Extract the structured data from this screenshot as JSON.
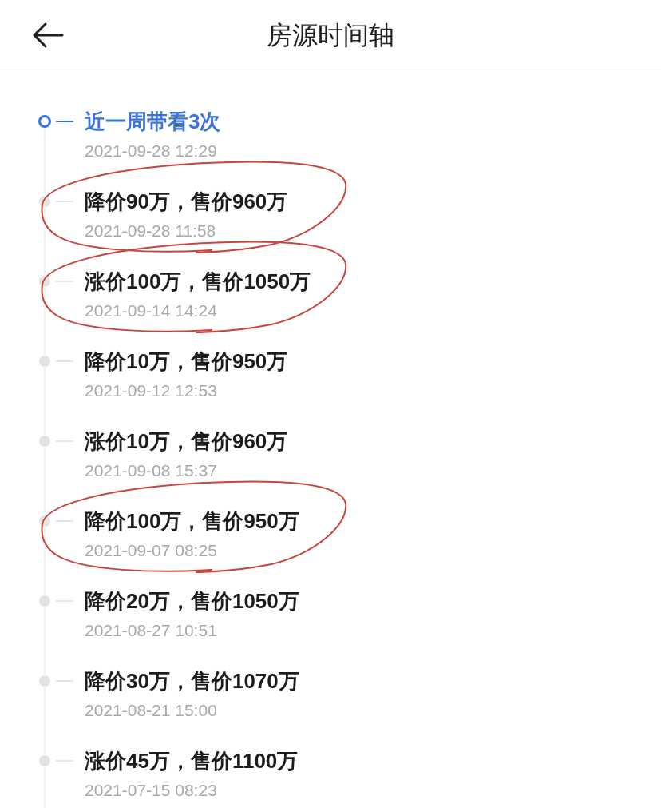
{
  "header": {
    "title": "房源时间轴"
  },
  "timeline": [
    {
      "title": "近一周带看3次",
      "time": "2021-09-28 12:29",
      "current": true,
      "circled": false
    },
    {
      "title": "降价90万，售价960万",
      "time": "2021-09-28 11:58",
      "current": false,
      "circled": true
    },
    {
      "title": "涨价100万，售价1050万",
      "time": "2021-09-14 14:24",
      "current": false,
      "circled": true
    },
    {
      "title": "降价10万，售价950万",
      "time": "2021-09-12 12:53",
      "current": false,
      "circled": false
    },
    {
      "title": "涨价10万，售价960万",
      "time": "2021-09-08 15:37",
      "current": false,
      "circled": false
    },
    {
      "title": "降价100万，售价950万",
      "time": "2021-09-07 08:25",
      "current": false,
      "circled": true
    },
    {
      "title": "降价20万，售价1050万",
      "time": "2021-08-27 10:51",
      "current": false,
      "circled": false
    },
    {
      "title": "降价30万，售价1070万",
      "time": "2021-08-21 15:00",
      "current": false,
      "circled": false
    },
    {
      "title": "涨价45万，售价1100万",
      "time": "2021-07-15 08:23",
      "current": false,
      "circled": false
    }
  ]
}
